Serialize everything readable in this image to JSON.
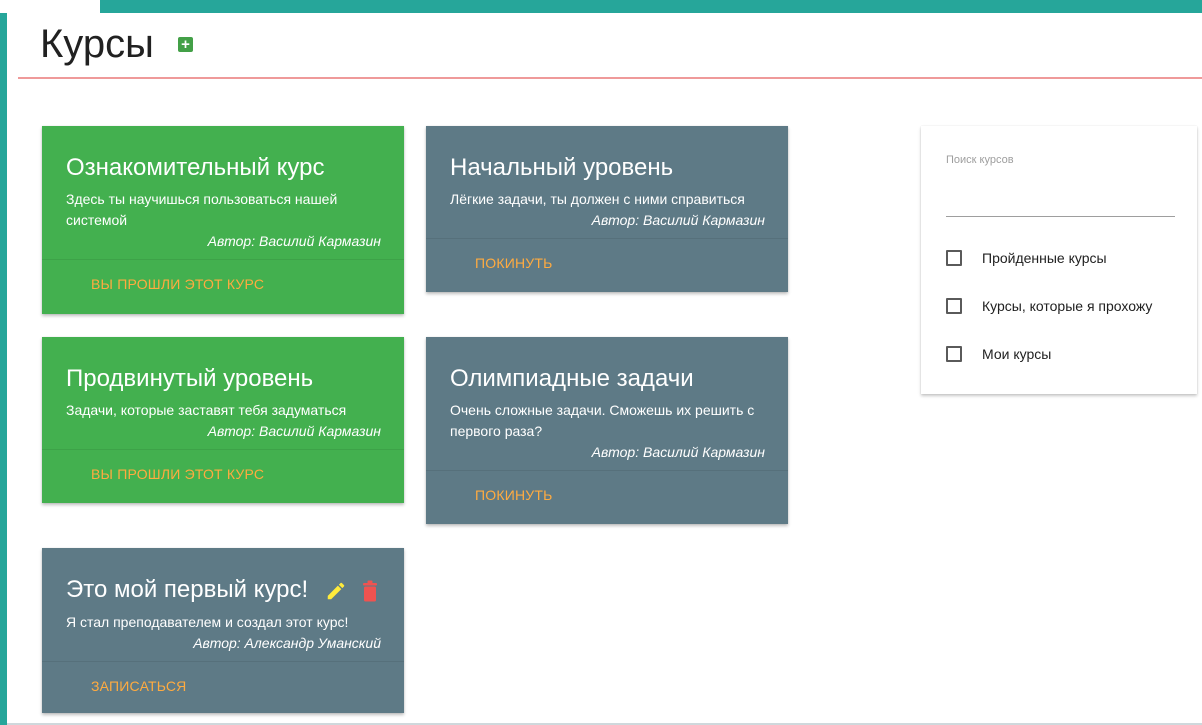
{
  "header": {
    "title": "Курсы",
    "add_icon": "plus-square-icon"
  },
  "courses": [
    {
      "title": "Ознакомительный курс",
      "description": "Здесь ты научишься пользоваться нашей системой",
      "author": "Автор: Василий Кармазин",
      "action": "Вы прошли этот курс",
      "color": "#43b04f"
    },
    {
      "title": "Начальный уровень",
      "description": "Лёгкие задачи, ты должен с ними справиться",
      "author": "Автор: Василий Кармазин",
      "action": "Покинуть",
      "color": "#5e7a86"
    },
    {
      "title": "Продвинутый уровень",
      "description": "Задачи, которые заставят тебя задуматься",
      "author": "Автор: Василий Кармазин",
      "action": "Вы прошли этот курс",
      "color": "#43b04f"
    },
    {
      "title": "Олимпиадные задачи",
      "description": "Очень сложные задачи. Сможешь их решить с первого раза?",
      "author": "Автор: Василий Кармазин",
      "action": "Покинуть",
      "color": "#5e7a86"
    },
    {
      "title": "Это мой первый курс!",
      "description": "Я стал преподавателем и создал этот курс!",
      "author": "Автор: Александр Уманский",
      "action": "Записаться",
      "color": "#5e7a86",
      "icons": [
        "pencil-icon",
        "trash-icon"
      ]
    }
  ],
  "filters": {
    "search_label": "Поиск курсов",
    "search_value": "",
    "checkboxes": [
      {
        "label": "Пройденные курсы",
        "checked": false
      },
      {
        "label": "Курсы, которые я прохожу",
        "checked": false
      },
      {
        "label": "Мои курсы",
        "checked": false
      }
    ]
  },
  "colors": {
    "accent": "#26a69a",
    "action_text": "#ffab40",
    "header_rule": "#ef9a9a",
    "pencil": "#ffeb3b",
    "trash": "#ef5350"
  }
}
